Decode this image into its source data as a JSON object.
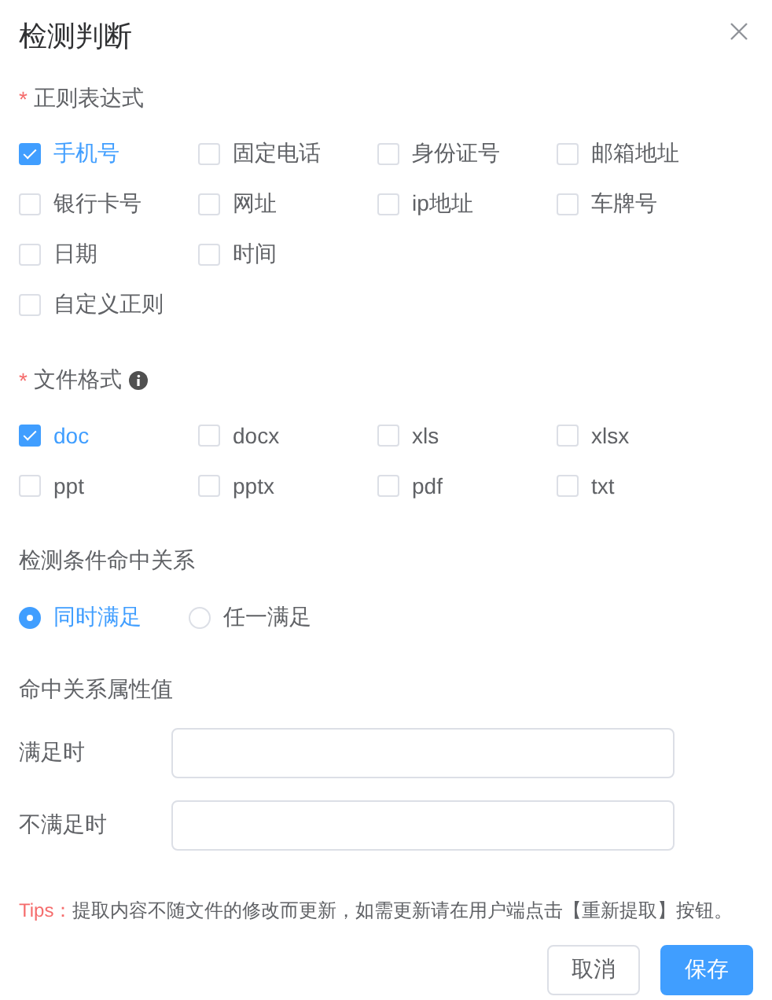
{
  "dialog": {
    "title": "检测判断"
  },
  "regex": {
    "label": "正则表达式",
    "required_mark": "*",
    "rows": [
      [
        {
          "label": "手机号",
          "checked": true
        },
        {
          "label": "固定电话",
          "checked": false
        },
        {
          "label": "身份证号",
          "checked": false
        },
        {
          "label": "邮箱地址",
          "checked": false
        }
      ],
      [
        {
          "label": "银行卡号",
          "checked": false
        },
        {
          "label": "网址",
          "checked": false
        },
        {
          "label": "ip地址",
          "checked": false
        },
        {
          "label": "车牌号",
          "checked": false
        }
      ],
      [
        {
          "label": "日期",
          "checked": false
        },
        {
          "label": "时间",
          "checked": false
        }
      ],
      [
        {
          "label": "自定义正则",
          "checked": false
        }
      ]
    ]
  },
  "file_format": {
    "label": "文件格式",
    "required_mark": "*",
    "info": true,
    "rows": [
      [
        {
          "label": "doc",
          "checked": true
        },
        {
          "label": "docx",
          "checked": false
        },
        {
          "label": "xls",
          "checked": false
        },
        {
          "label": "xlsx",
          "checked": false
        }
      ],
      [
        {
          "label": "ppt",
          "checked": false
        },
        {
          "label": "pptx",
          "checked": false
        },
        {
          "label": "pdf",
          "checked": false
        },
        {
          "label": "txt",
          "checked": false
        }
      ]
    ]
  },
  "match_relation": {
    "label": "检测条件命中关系",
    "options": [
      {
        "label": "同时满足",
        "selected": true
      },
      {
        "label": "任一满足",
        "selected": false
      }
    ]
  },
  "attribute_values": {
    "label": "命中关系属性值",
    "fields": [
      {
        "label": "满足时"
      },
      {
        "label": "不满足时"
      }
    ]
  },
  "tips": {
    "label": "Tips：",
    "text": "提取内容不随文件的修改而更新，如需更新请在用户端点击【重新提取】按钮。"
  },
  "buttons": [
    {
      "label": "取消",
      "kind": "default"
    },
    {
      "label": "保存",
      "kind": "primary"
    }
  ]
}
